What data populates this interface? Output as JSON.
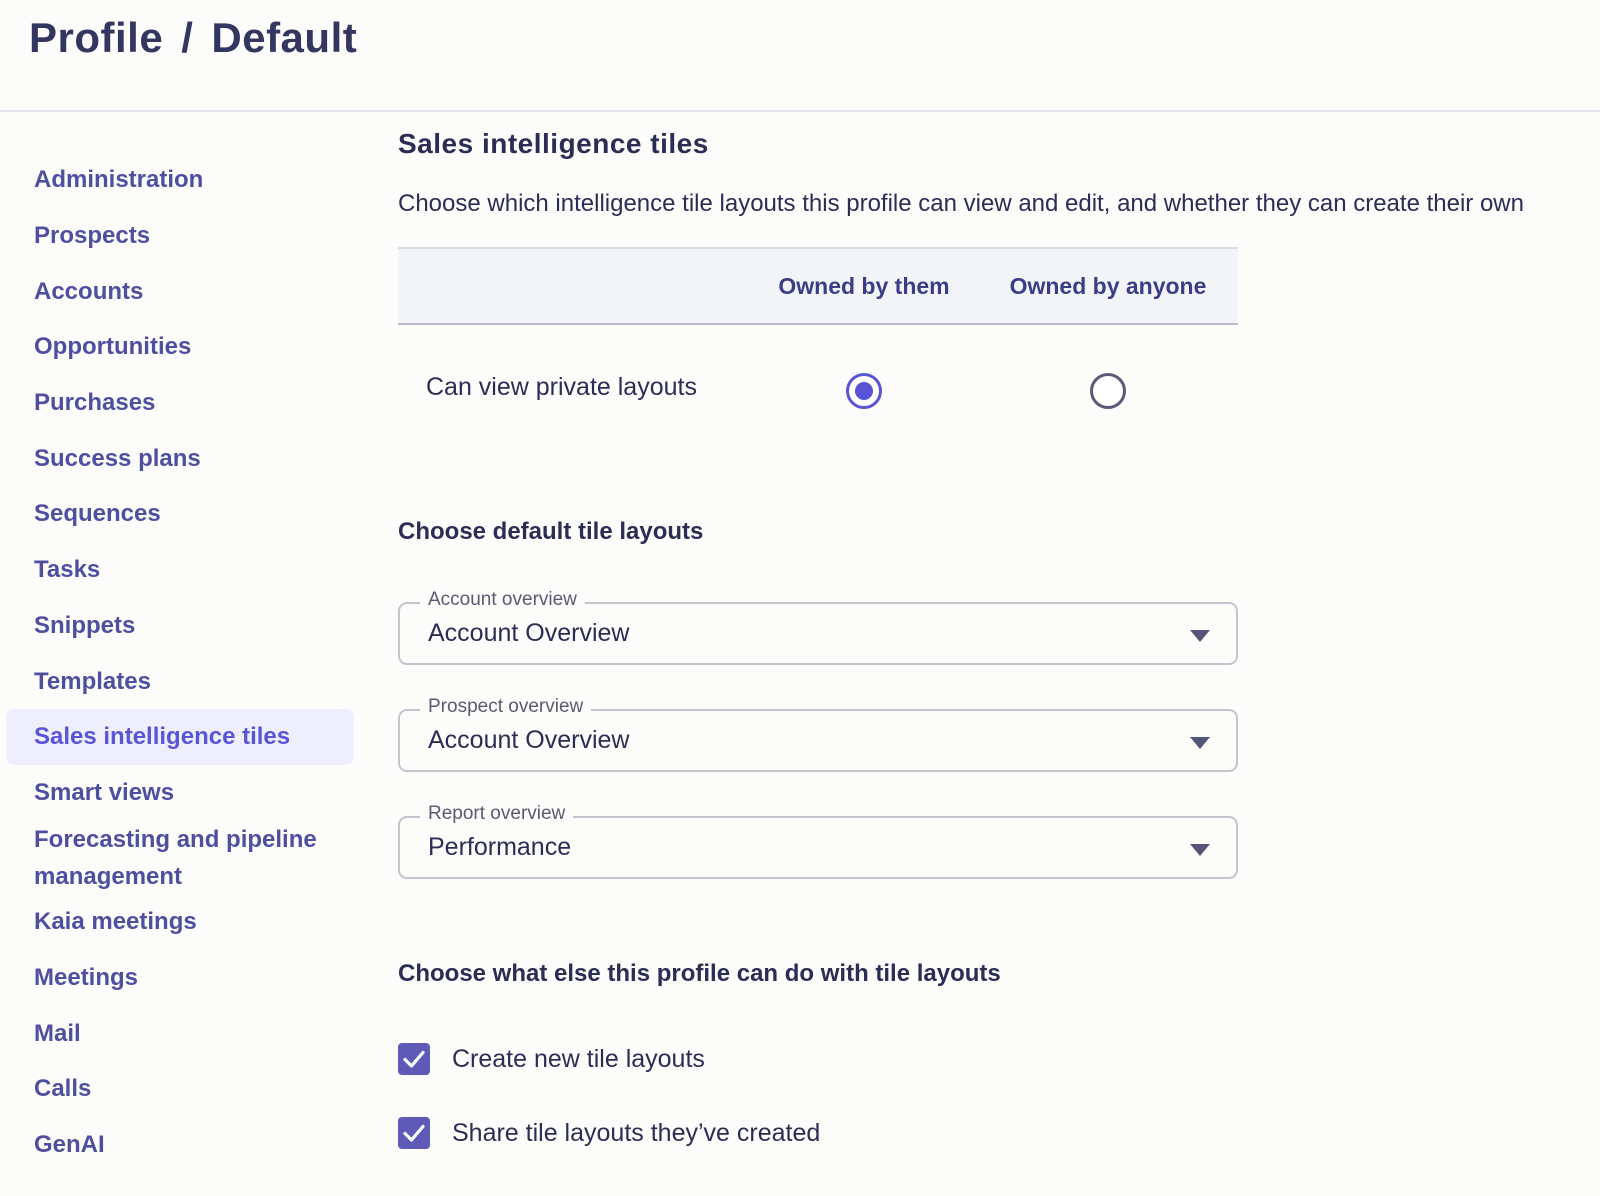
{
  "header": {
    "breadcrumb_root": "Profile",
    "breadcrumb_separator": "/",
    "breadcrumb_current": "Default"
  },
  "sidebar": {
    "active_index": 10,
    "items": [
      {
        "label": "Administration"
      },
      {
        "label": "Prospects"
      },
      {
        "label": "Accounts"
      },
      {
        "label": "Opportunities"
      },
      {
        "label": "Purchases"
      },
      {
        "label": "Success plans"
      },
      {
        "label": "Sequences"
      },
      {
        "label": "Tasks"
      },
      {
        "label": "Snippets"
      },
      {
        "label": "Templates"
      },
      {
        "label": "Sales intelligence tiles"
      },
      {
        "label": "Smart views"
      },
      {
        "label": "Forecasting and pipeline management"
      },
      {
        "label": "Kaia meetings"
      },
      {
        "label": "Meetings"
      },
      {
        "label": "Mail"
      },
      {
        "label": "Calls"
      },
      {
        "label": "GenAI"
      }
    ]
  },
  "main": {
    "title": "Sales intelligence tiles",
    "description": "Choose which intelligence tile layouts this profile can view and edit, and whether they can create their own",
    "permissions": {
      "columns": [
        "Owned by them",
        "Owned by anyone"
      ],
      "rows": [
        {
          "label": "Can view private layouts",
          "selected": "Owned by them"
        }
      ]
    },
    "defaults": {
      "title": "Choose default tile layouts",
      "fields": [
        {
          "label": "Account overview",
          "value": "Account Overview"
        },
        {
          "label": "Prospect overview",
          "value": "Account Overview"
        },
        {
          "label": "Report overview",
          "value": "Performance"
        }
      ]
    },
    "extras": {
      "title": "Choose what else this profile can do with tile layouts",
      "options": [
        {
          "label": "Create new tile layouts",
          "checked": true
        },
        {
          "label": "Share tile layouts they’ve created",
          "checked": true
        }
      ]
    }
  },
  "colors": {
    "accent": "#5a55d6",
    "checkbox": "#5f5ab8",
    "nav_text": "#4f4fa0",
    "active_bg": "#eeeefc",
    "text": "#2b2d54"
  },
  "icons": {
    "caret": "caret-down-icon",
    "check": "checkmark-icon"
  }
}
